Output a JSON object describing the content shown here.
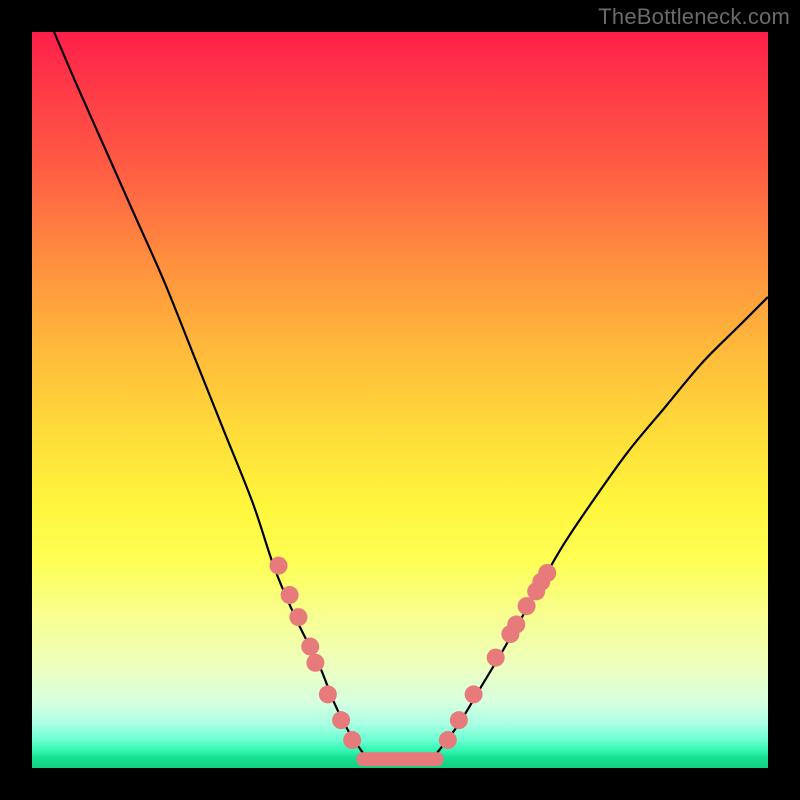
{
  "watermark": "TheBottleneck.com",
  "chart_data": {
    "type": "line",
    "title": "",
    "xlabel": "",
    "ylabel": "",
    "xlim": [
      0,
      100
    ],
    "ylim": [
      0,
      100
    ],
    "grid": false,
    "legend": false,
    "series": [
      {
        "name": "left-curve",
        "x": [
          3,
          6,
          10,
          14,
          18,
          22,
          26,
          30,
          33,
          36,
          39,
          41,
          43,
          45
        ],
        "y": [
          100,
          93,
          84,
          75,
          66,
          56,
          46,
          36,
          27,
          20,
          14,
          9,
          5,
          2
        ]
      },
      {
        "name": "right-curve",
        "x": [
          55,
          58,
          61,
          64,
          68,
          72,
          76,
          81,
          86,
          91,
          96,
          100
        ],
        "y": [
          2,
          6,
          11,
          16,
          23,
          30,
          36,
          43,
          49,
          55,
          60,
          64
        ]
      },
      {
        "name": "valley-flat",
        "x": [
          45,
          55
        ],
        "y": [
          1.2,
          1.2
        ]
      }
    ],
    "points": {
      "name": "markers",
      "coords": [
        [
          33.5,
          27.5
        ],
        [
          35.0,
          23.5
        ],
        [
          36.2,
          20.5
        ],
        [
          37.8,
          16.5
        ],
        [
          38.5,
          14.3
        ],
        [
          40.2,
          10.0
        ],
        [
          42.0,
          6.5
        ],
        [
          43.5,
          3.8
        ],
        [
          56.5,
          3.8
        ],
        [
          58.0,
          6.5
        ],
        [
          60.0,
          10.0
        ],
        [
          63.0,
          15.0
        ],
        [
          65.0,
          18.2
        ],
        [
          65.8,
          19.5
        ],
        [
          67.2,
          22.0
        ],
        [
          68.5,
          24.0
        ],
        [
          69.2,
          25.3
        ],
        [
          70.0,
          26.5
        ]
      ]
    },
    "colors": {
      "curve": "#000000",
      "marker": "#e77b7b",
      "gradient_top": "#ff1e4a",
      "gradient_bottom": "#0fd07f"
    }
  }
}
